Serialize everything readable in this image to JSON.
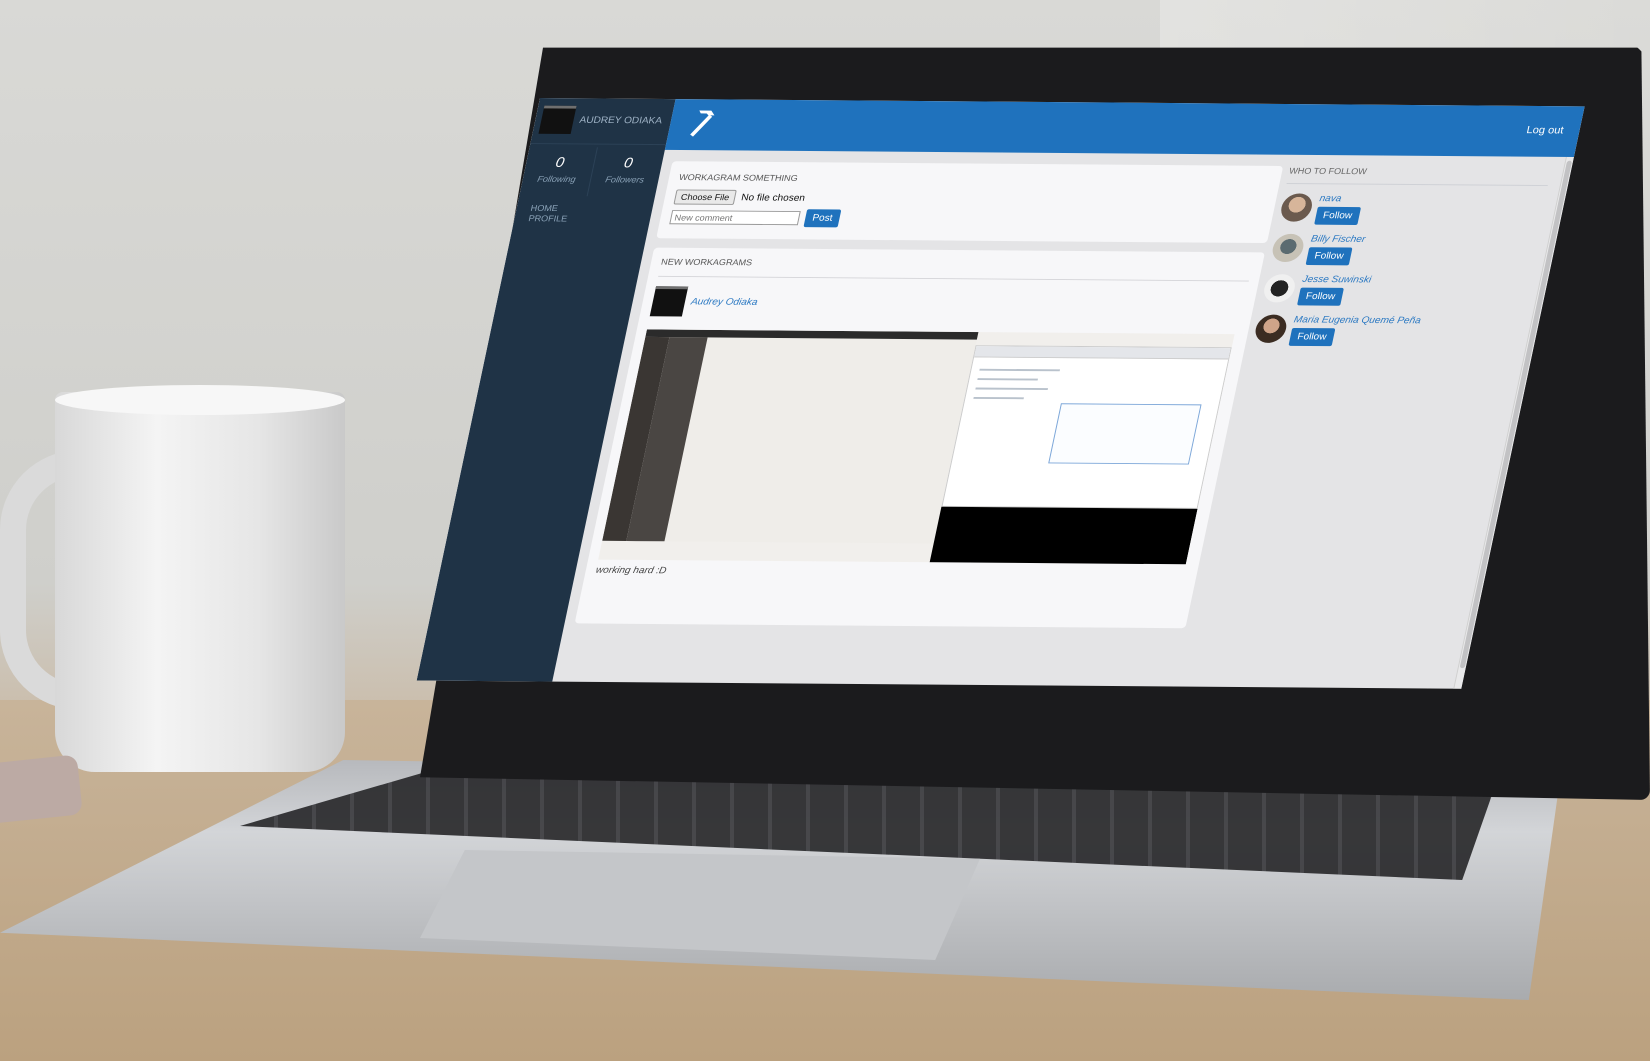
{
  "sidebar": {
    "username": "AUDREY ODIAKA",
    "stats": [
      {
        "value": "0",
        "label": "Following"
      },
      {
        "value": "0",
        "label": "Followers"
      }
    ],
    "nav": [
      {
        "label": "HOME"
      },
      {
        "label": "PROFILE"
      }
    ]
  },
  "topbar": {
    "logout_label": "Log out",
    "logo_icon": "hammer-icon"
  },
  "composer": {
    "title": "WORKAGRAM SOMETHING",
    "file_button": "Choose File",
    "file_status": "No file chosen",
    "comment_placeholder": "New comment",
    "post_label": "Post"
  },
  "feed": {
    "title": "NEW WORKAGRAMS",
    "posts": [
      {
        "author": "Audrey Odiaka",
        "caption": "working hard :D"
      }
    ]
  },
  "who_to_follow": {
    "title": "WHO TO FOLLOW",
    "users": [
      {
        "name": "nava",
        "button": "Follow"
      },
      {
        "name": "Billy Fischer",
        "button": "Follow"
      },
      {
        "name": "Jesse Suwinski",
        "button": "Follow"
      },
      {
        "name": "Maria Eugenia Quemé Peña",
        "button": "Follow"
      }
    ]
  },
  "colors": {
    "brand_blue": "#1f72bd",
    "sidebar_navy": "#1f3346",
    "link_blue": "#2a78c2"
  }
}
